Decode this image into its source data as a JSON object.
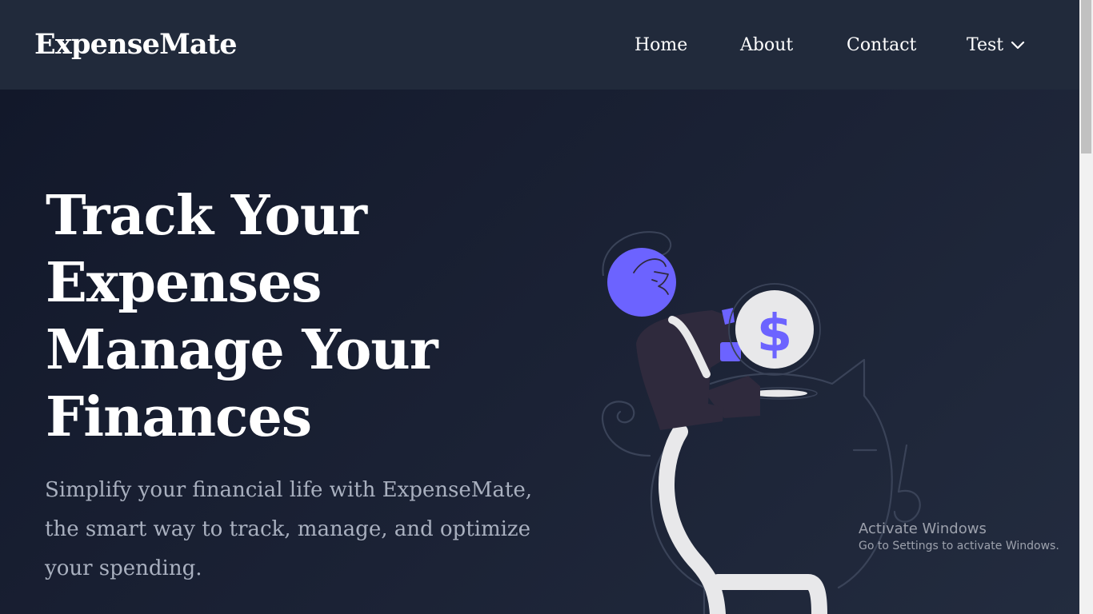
{
  "navbar": {
    "brand": "ExpenseMate",
    "links": [
      "Home",
      "About",
      "Contact"
    ],
    "dropdown_label": "Test",
    "dropdown_icon": "chevron-down-icon"
  },
  "hero": {
    "title_lines": [
      "Track Your",
      "Expenses",
      "Manage Your",
      "Finances"
    ],
    "subtitle": "Simplify your financial life with ExpenseMate, the smart way to track, manage, and optimize your spending."
  },
  "illustration": {
    "coin_symbol": "$",
    "accent_color": "#6c63ff"
  },
  "watermark": {
    "title": "Activate Windows",
    "subtitle": "Go to Settings to activate Windows."
  },
  "colors": {
    "background": "#141b2d",
    "navbar": "#212a3b",
    "text": "#ffffff",
    "muted_text": "#a9b0bf"
  }
}
